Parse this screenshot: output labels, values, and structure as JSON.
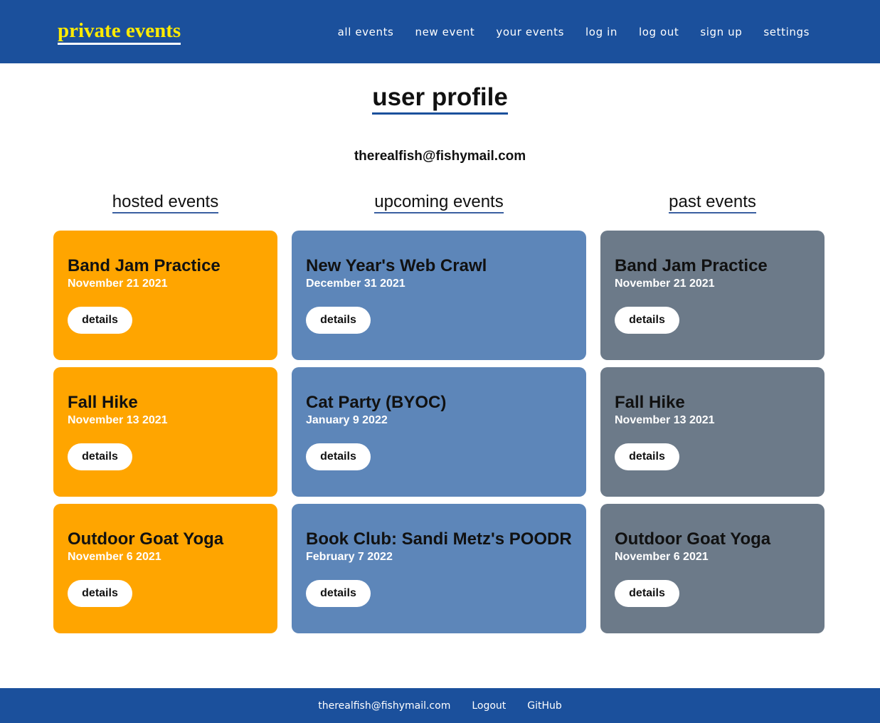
{
  "navbar": {
    "brand": "private events",
    "links": [
      "all events",
      "new event",
      "your events",
      "log in",
      "log out",
      "sign up",
      "settings"
    ]
  },
  "page": {
    "title": "user profile",
    "email": "therealfish@fishymail.com"
  },
  "colors": {
    "navbar": "#1b509c",
    "brand": "#ffeb00",
    "hosted_card": "#ffa500",
    "upcoming_card": "#5d86b9",
    "past_card": "#6c7a89"
  },
  "columns": {
    "hosted": {
      "heading": "hosted events",
      "events": [
        {
          "title": "Band Jam Practice",
          "date": "November 21 2021",
          "button": "details"
        },
        {
          "title": "Fall Hike",
          "date": "November 13 2021",
          "button": "details"
        },
        {
          "title": "Outdoor Goat Yoga",
          "date": "November 6 2021",
          "button": "details"
        }
      ]
    },
    "upcoming": {
      "heading": "upcoming events",
      "events": [
        {
          "title": "New Year's Web Crawl",
          "date": "December 31 2021",
          "button": "details"
        },
        {
          "title": "Cat Party (BYOC)",
          "date": "January 9 2022",
          "button": "details"
        },
        {
          "title": "Book Club: Sandi Metz's POODR",
          "date": "February 7 2022",
          "button": "details"
        }
      ]
    },
    "past": {
      "heading": "past events",
      "events": [
        {
          "title": "Band Jam Practice",
          "date": "November 21 2021",
          "button": "details"
        },
        {
          "title": "Fall Hike",
          "date": "November 13 2021",
          "button": "details"
        },
        {
          "title": "Outdoor Goat Yoga",
          "date": "November 6 2021",
          "button": "details"
        }
      ]
    }
  },
  "footer": {
    "links": [
      "therealfish@fishymail.com",
      "Logout",
      "GitHub"
    ]
  }
}
